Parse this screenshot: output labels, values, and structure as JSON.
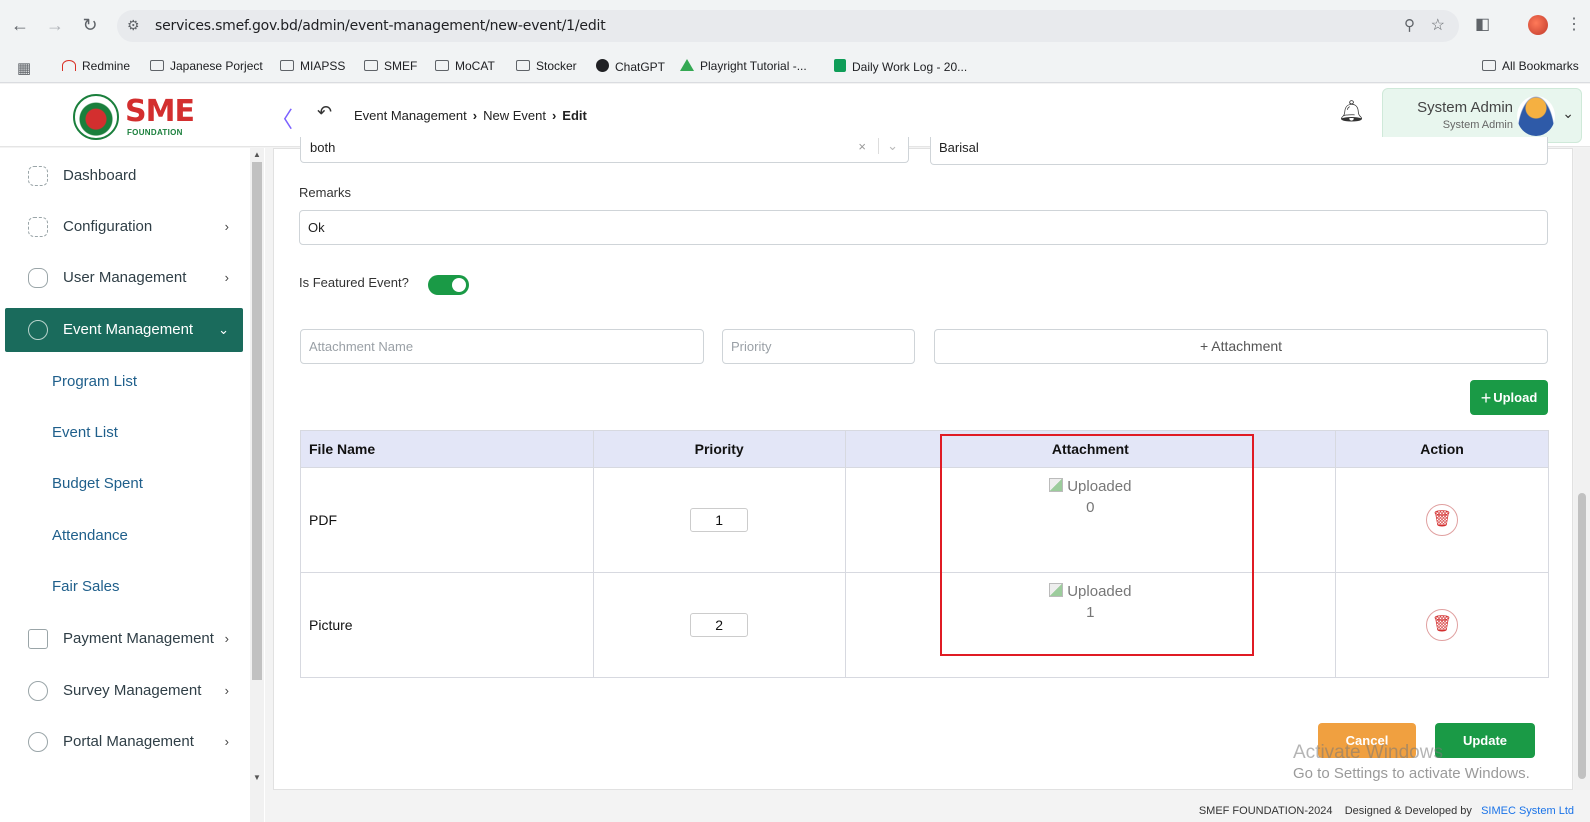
{
  "browser": {
    "url": "services.smef.gov.bd/admin/event-management/new-event/1/edit",
    "bookmarks": [
      "Redmine",
      "Japanese Porject",
      "MIAPSS",
      "SMEF",
      "MoCAT",
      "Stocker",
      "ChatGPT",
      "Playright Tutorial -...",
      "Daily Work Log - 20..."
    ],
    "all_bookmarks": "All Bookmarks"
  },
  "header": {
    "logo_text": "SME",
    "logo_sub": "FOUNDATION",
    "breadcrumb": [
      "Event Management",
      "New Event",
      "Edit"
    ],
    "user_name": "System Admin",
    "user_role": "System Admin"
  },
  "sidebar": {
    "items": [
      {
        "label": "Dashboard",
        "icon": "dashboard-icon"
      },
      {
        "label": "Configuration",
        "icon": "config-icon"
      },
      {
        "label": "User Management",
        "icon": "user-icon"
      },
      {
        "label": "Event Management",
        "icon": "event-icon"
      },
      {
        "label": "Payment Management",
        "icon": "payment-icon"
      },
      {
        "label": "Survey Management",
        "icon": "survey-icon"
      },
      {
        "label": "Portal Management",
        "icon": "portal-icon"
      }
    ],
    "subitems": [
      "Program List",
      "Event List",
      "Budget Spent",
      "Attendance",
      "Fair Sales"
    ]
  },
  "form": {
    "audience_value": "both",
    "division_value": "Barisal",
    "remarks_label": "Remarks",
    "remarks_value": "Ok",
    "featured_label": "Is Featured Event?",
    "featured_on": true,
    "attachment_name_placeholder": "Attachment Name",
    "priority_placeholder": "Priority",
    "add_attachment_label": "+ Attachment",
    "upload_label": "Upload"
  },
  "table": {
    "headers": [
      "File Name",
      "Priority",
      "Attachment",
      "Action"
    ],
    "rows": [
      {
        "file_name": "PDF",
        "priority": "1",
        "attachment_alt": "Uploaded",
        "attachment_index": "0"
      },
      {
        "file_name": "Picture",
        "priority": "2",
        "attachment_alt": "Uploaded",
        "attachment_index": "1"
      }
    ]
  },
  "actions": {
    "cancel": "Cancel",
    "update": "Update"
  },
  "watermark": {
    "line1": "Activate Windows",
    "line2": "Go to Settings to activate Windows."
  },
  "footer": {
    "copyright": "SMEF FOUNDATION-2024",
    "designed_by": "Designed & Developed by",
    "company": "SIMEC System Ltd"
  },
  "colors": {
    "primary": "#1a9a46",
    "sidebar_active": "#1a6b5c",
    "cancel": "#f0a040",
    "highlight": "#e01b24",
    "table_header": "#e3e6f7"
  }
}
